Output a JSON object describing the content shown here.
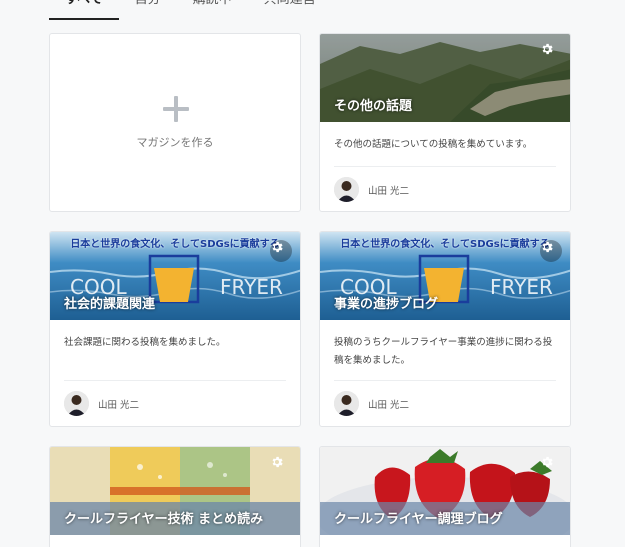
{
  "tabs": [
    {
      "label": "すべて",
      "active": true
    },
    {
      "label": "自分",
      "active": false
    },
    {
      "label": "購読中",
      "active": false
    },
    {
      "label": "共同運営",
      "active": false
    }
  ],
  "create": {
    "label": "マガジンを作る"
  },
  "author": {
    "name": "山田 光二"
  },
  "banner_text": "日本と世界の食文化、そしてSDGsに貢献する",
  "cool_fryer_text": {
    "left": "COOL",
    "right": "FRYER"
  },
  "magazines": [
    {
      "title": "その他の話題",
      "description": "その他の話題についての投稿を集めています。"
    },
    {
      "title": "社会的課題関連",
      "description": "社会課題に関わる投稿を集めました。"
    },
    {
      "title": "事業の進捗ブログ",
      "description": "投稿のうちクールフライヤー事業の進捗に関わる投稿を集めました。"
    },
    {
      "title": "クールフライヤー技術 まとめ読み",
      "description": ""
    },
    {
      "title": "クールフライヤー調理ブログ",
      "description": ""
    }
  ],
  "colors": {
    "gear_bg": "rgba(0,0,0,0.35)",
    "accent_blue": "#1a3d9c"
  }
}
